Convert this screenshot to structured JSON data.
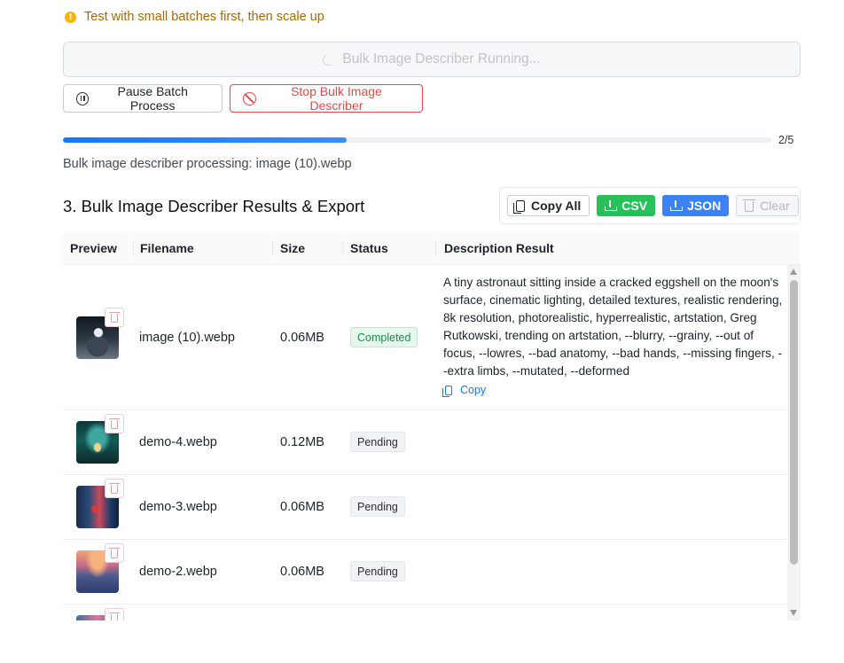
{
  "tip": {
    "icon": "info-icon",
    "text": "Test with small batches first, then scale up",
    "color": "#a66a00"
  },
  "running_button": {
    "label": "Bulk Image Describer Running..."
  },
  "controls": {
    "pause_label": "Pause Batch Process",
    "stop_label": "Stop Bulk Image Describer"
  },
  "progress": {
    "current": 2,
    "total": 5,
    "fraction": 0.4,
    "count_text": "2/5",
    "accent": "#1677ff"
  },
  "processing_text": "Bulk image describer processing: image (10).webp",
  "results": {
    "title": "3. Bulk Image Describer Results & Export",
    "export": {
      "copy_all": "Copy All",
      "csv": "CSV",
      "json": "JSON",
      "clear": "Clear"
    },
    "columns": {
      "preview": "Preview",
      "filename": "Filename",
      "size": "Size",
      "status": "Status",
      "description": "Description Result"
    },
    "rows": [
      {
        "filename": "image (10).webp",
        "size": "0.06MB",
        "status": "Completed",
        "description": "A tiny astronaut sitting inside a cracked eggshell on the moon's surface, cinematic lighting, detailed textures, realistic rendering, 8k resolution, photorealistic, hyperrealistic, artstation, Greg Rutkowski, trending on artstation, --blurry, --grainy, --out of focus, --lowres, --bad anatomy, --bad hands, --missing fingers, --extra limbs, --mutated, --deformed",
        "copy_label": "Copy"
      },
      {
        "filename": "demo-4.webp",
        "size": "0.12MB",
        "status": "Pending"
      },
      {
        "filename": "demo-3.webp",
        "size": "0.06MB",
        "status": "Pending"
      },
      {
        "filename": "demo-2.webp",
        "size": "0.06MB",
        "status": "Pending"
      }
    ]
  },
  "colors": {
    "success": "#27c15c",
    "primary": "#3b82f6",
    "danger": "#e5484d",
    "completed_tag": "#1f8a4c"
  }
}
